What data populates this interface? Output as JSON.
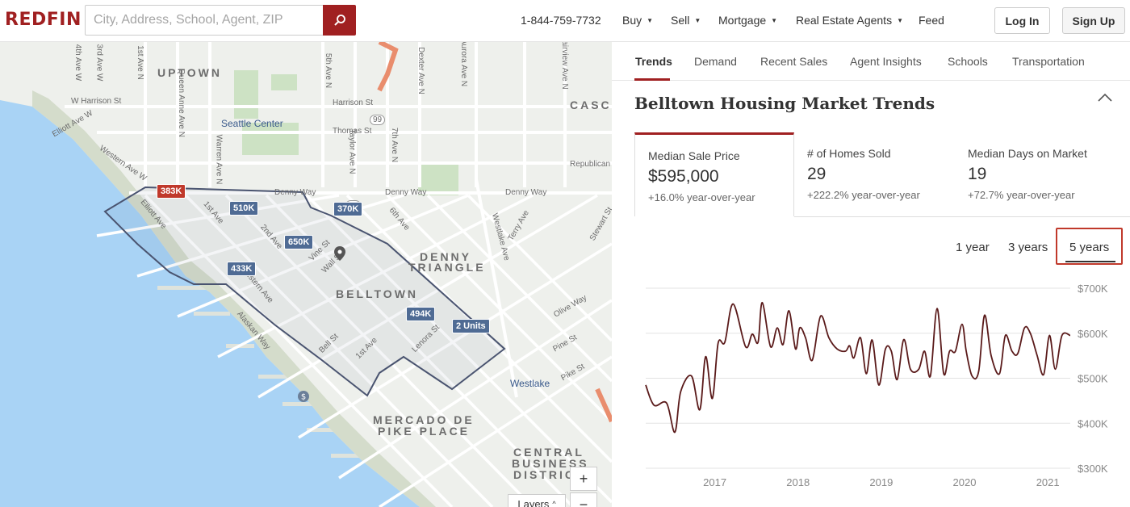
{
  "header": {
    "logo": "REDFIN",
    "search_placeholder": "City, Address, School, Agent, ZIP",
    "phone": "1-844-759-7732",
    "nav": [
      "Buy",
      "Sell",
      "Mortgage",
      "Real Estate Agents",
      "Feed"
    ],
    "login": "Log In",
    "signup": "Sign Up",
    "accent_color": "#a02021"
  },
  "map": {
    "neighborhoods": [
      "UPTOWN",
      "DENNY",
      "TRIANGLE",
      "BELLTOWN",
      "MERCADO DE",
      "PIKE PLACE",
      "CENTRAL",
      "BUSINESS",
      "DISTRIC",
      "CASC"
    ],
    "streets": [
      "Elliott Ave W",
      "W Harrison St",
      "Western Ave W",
      "Seattle Center",
      "Thomas St",
      "Harrison St",
      "Denny Way",
      "Elliott Ave",
      "1st Ave",
      "2nd Ave",
      "Vine St",
      "Wall St",
      "6th Ave",
      "Western Ave",
      "Alaskan Way",
      "Bell St",
      "Lenora St",
      "Olive Way",
      "Pine St",
      "Pike St",
      "Westlake",
      "Westlake Ave",
      "Terry Ave",
      "Stewart St",
      "Dexter Ave N",
      "7th Ave N",
      "Taylor Ave N",
      "5th Ave N",
      "Queen Anne Ave N",
      "3rd Ave W",
      "4th Ave W",
      "1st Ave N",
      "Warren Ave N",
      "Republican St",
      "Aurora Ave N",
      "Fairview Ave N"
    ],
    "pins": [
      "383K",
      "510K",
      "370K",
      "650K",
      "433K",
      "494K",
      "2 Units"
    ],
    "route_badge": "99",
    "zoom_in": "+",
    "zoom_out": "−",
    "layers": "Layers"
  },
  "panel": {
    "tabs": [
      "Trends",
      "Demand",
      "Recent Sales",
      "Agent Insights",
      "Schools",
      "Transportation"
    ],
    "title": "Belltown Housing Market Trends",
    "stats": [
      {
        "label": "Median Sale Price",
        "value": "$595,000",
        "change": "+16.0% year-over-year"
      },
      {
        "label": "# of Homes Sold",
        "value": "29",
        "change": "+222.2% year-over-year"
      },
      {
        "label": "Median Days on Market",
        "value": "19",
        "change": "+72.7% year-over-year"
      }
    ],
    "periods": [
      "1 year",
      "3 years",
      "5 years"
    ],
    "selected_period": "5 years"
  },
  "chart_data": {
    "type": "line",
    "title": "",
    "xlabel": "",
    "ylabel": "",
    "x_tick_labels": [
      "2017",
      "2018",
      "2019",
      "2020",
      "2021"
    ],
    "y_tick_labels": [
      "$300K",
      "$400K",
      "$500K",
      "$600K",
      "$700K"
    ],
    "ylim": [
      300000,
      700000
    ],
    "xlim": [
      2016.2,
      2021.3
    ],
    "grid": "horizontal",
    "line_color": "#5a1a1a",
    "series": [
      {
        "x": [
          2016.2,
          2016.3,
          2016.45,
          2016.55,
          2016.62,
          2016.75,
          2016.85,
          2016.92,
          2017.0,
          2017.07,
          2017.15,
          2017.25,
          2017.4,
          2017.48,
          2017.55,
          2017.6,
          2017.7,
          2017.78,
          2017.85,
          2017.92,
          2018.0,
          2018.05,
          2018.12,
          2018.2,
          2018.3,
          2018.4,
          2018.5,
          2018.6,
          2018.65,
          2018.7,
          2018.78,
          2018.85,
          2018.92,
          2019.0,
          2019.08,
          2019.15,
          2019.22,
          2019.3,
          2019.38,
          2019.48,
          2019.55,
          2019.62,
          2019.7,
          2019.78,
          2019.85,
          2019.92,
          2020.0,
          2020.05,
          2020.12,
          2020.2,
          2020.27,
          2020.35,
          2020.45,
          2020.52,
          2020.6,
          2020.67,
          2020.75,
          2020.82,
          2020.9,
          2020.98,
          2021.05,
          2021.12,
          2021.2,
          2021.3
        ],
        "y": [
          485000,
          440000,
          445000,
          380000,
          470000,
          505000,
          430000,
          548000,
          455000,
          578000,
          580000,
          665000,
          570000,
          598000,
          580000,
          668000,
          570000,
          612000,
          575000,
          650000,
          565000,
          612000,
          590000,
          540000,
          638000,
          590000,
          565000,
          560000,
          572000,
          545000,
          590000,
          510000,
          585000,
          485000,
          565000,
          560000,
          497000,
          586000,
          520000,
          520000,
          560000,
          505000,
          655000,
          510000,
          560000,
          560000,
          620000,
          560000,
          505000,
          515000,
          640000,
          550000,
          510000,
          595000,
          560000,
          555000,
          612000,
          600000,
          552000,
          508000,
          595000,
          520000,
          595000,
          595000
        ]
      }
    ]
  }
}
